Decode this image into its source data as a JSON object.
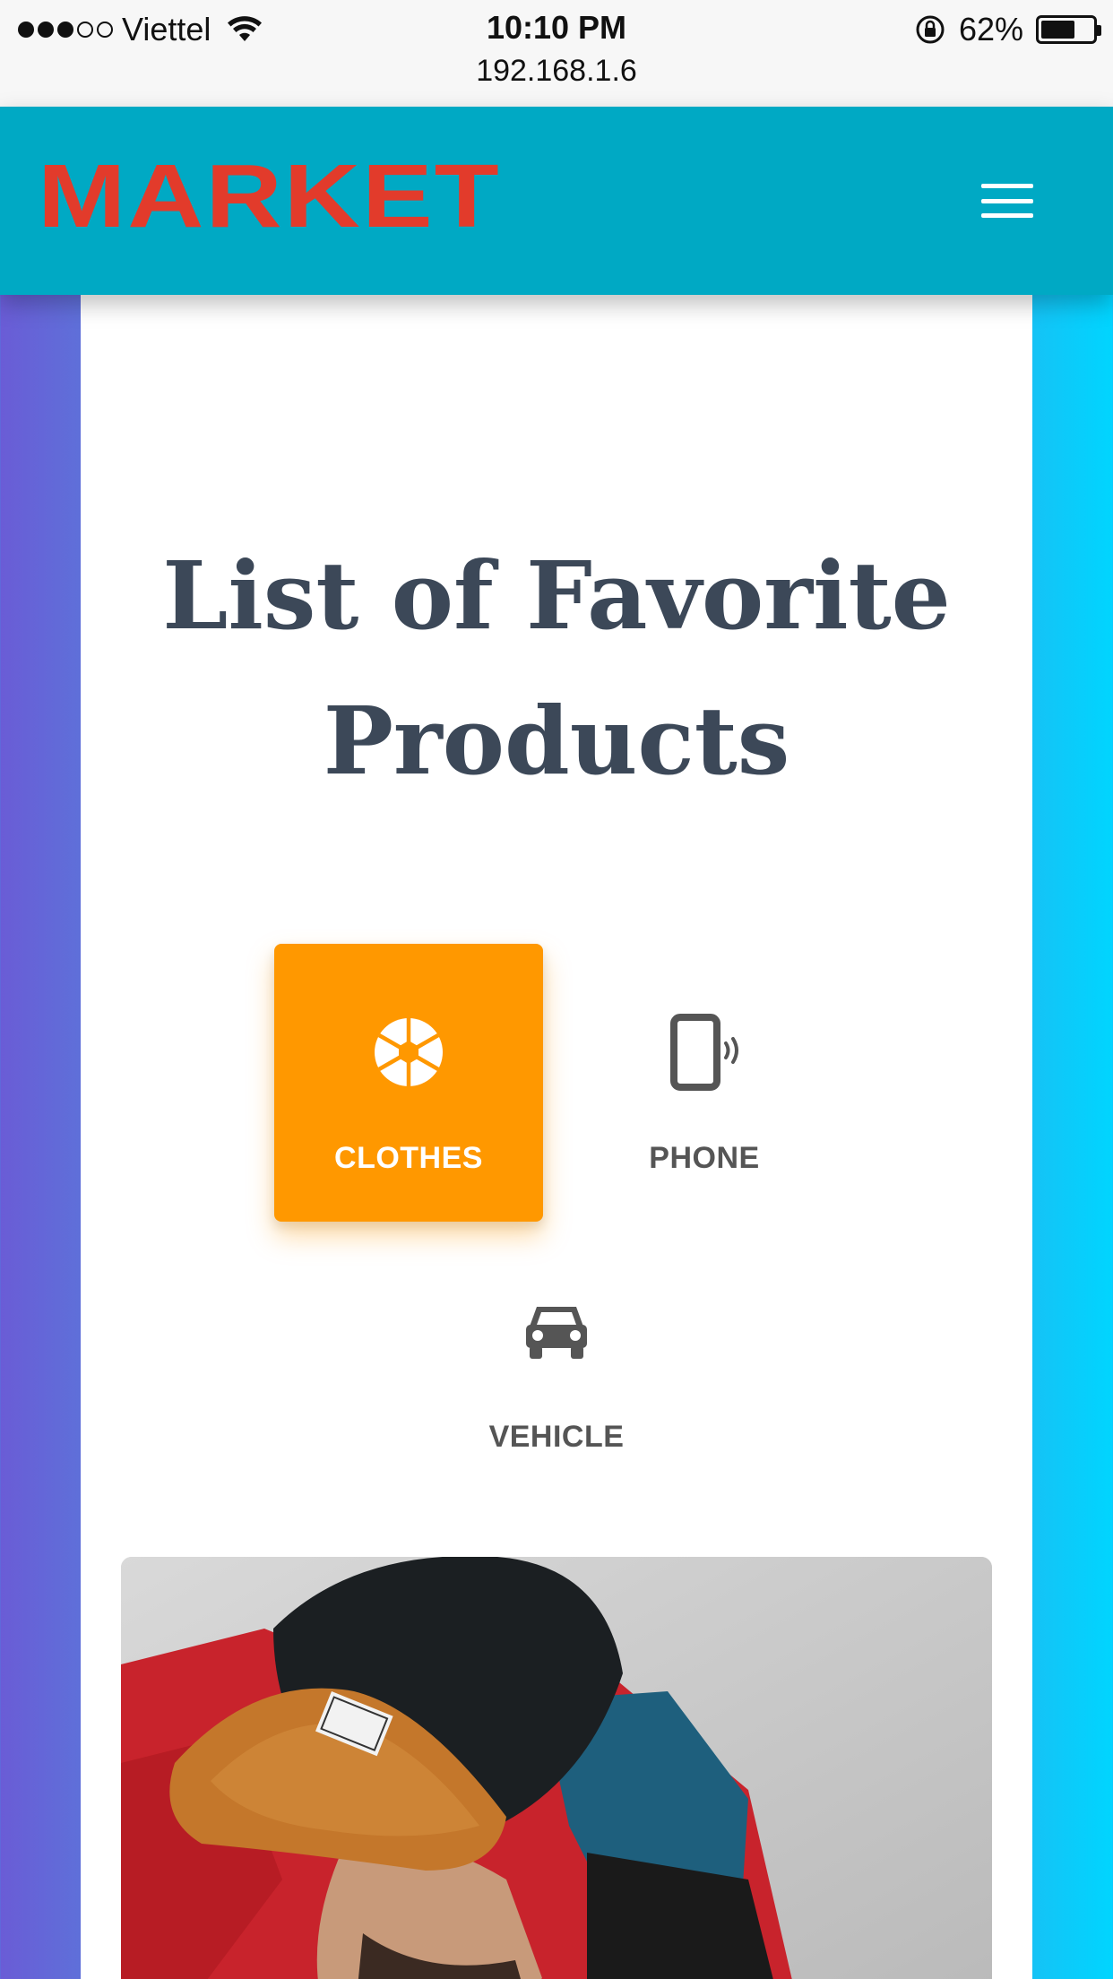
{
  "status_bar": {
    "carrier": "Viettel",
    "time": "10:10 PM",
    "url": "192.168.1.6",
    "battery": "62%",
    "battery_level": 0.62,
    "signal_bars_filled": 3,
    "signal_bars_total": 5
  },
  "header": {
    "logo": "MARKET",
    "logo_color": "#e23b2b",
    "background_color": "#00a9c4",
    "menu_icon": "hamburger-menu-icon"
  },
  "main": {
    "title": "List of Favorite Products",
    "categories": [
      {
        "label": "CLOTHES",
        "icon": "camera-aperture-icon",
        "active": true
      },
      {
        "label": "PHONE",
        "icon": "phone-vibrate-icon",
        "active": false
      },
      {
        "label": "VEHICLE",
        "icon": "car-icon",
        "active": false
      }
    ],
    "active_color": "#ff9800"
  }
}
